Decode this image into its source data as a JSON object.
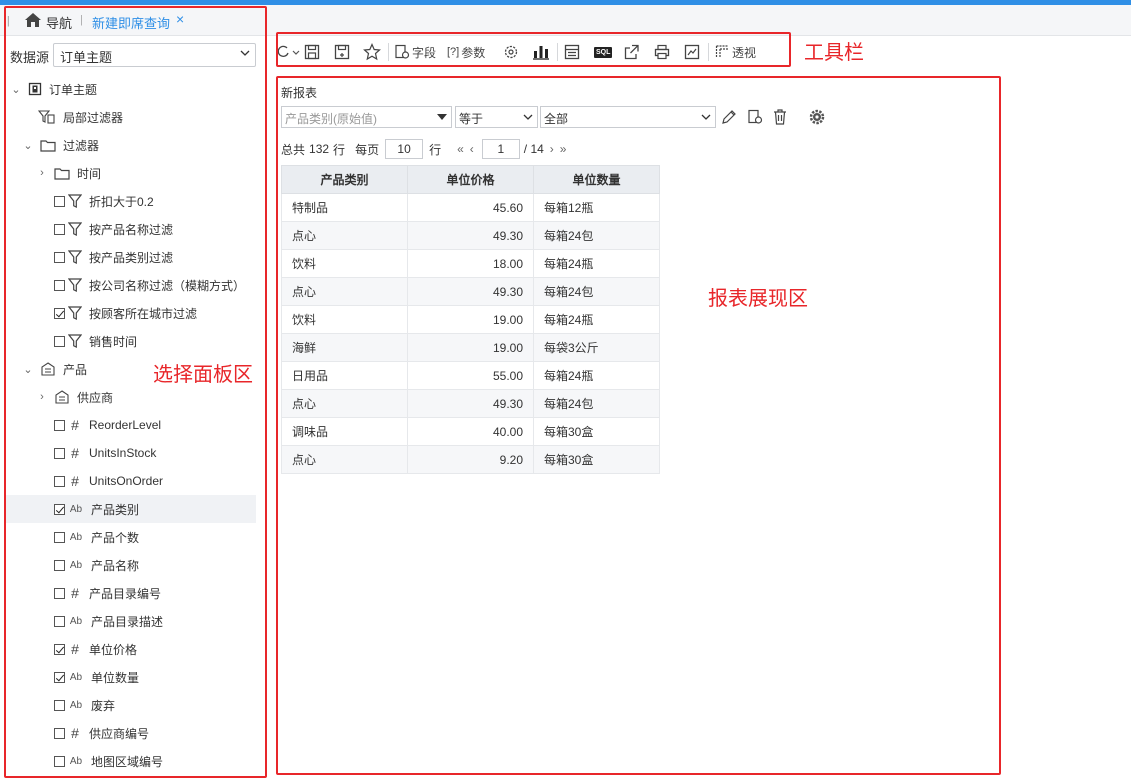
{
  "tabs": {
    "nav_label": "导航",
    "active_tab": "新建即席查询"
  },
  "datasource": {
    "label": "数据源",
    "value": "订单主题"
  },
  "tree": [
    {
      "label": "订单主题",
      "icon": "theme-icon",
      "twisty": "open",
      "checkbox": null
    },
    {
      "label": "局部过滤器",
      "icon": "local-filter-icon",
      "twisty": null,
      "checkbox": null
    },
    {
      "label": "过滤器",
      "icon": "folder-icon",
      "twisty": "open",
      "checkbox": null
    },
    {
      "label": "时间",
      "icon": "folder-icon",
      "twisty": "closed",
      "checkbox": null
    },
    {
      "label": "折扣大于0.2",
      "icon": "filter-icon",
      "twisty": null,
      "checkbox": false
    },
    {
      "label": "按产品名称过滤",
      "icon": "filter-icon",
      "twisty": null,
      "checkbox": false
    },
    {
      "label": "按产品类别过滤",
      "icon": "filter-icon",
      "twisty": null,
      "checkbox": false
    },
    {
      "label": "按公司名称过滤（模糊方式）",
      "icon": "filter-icon",
      "twisty": null,
      "checkbox": false
    },
    {
      "label": "按顾客所在城市过滤",
      "icon": "filter-icon",
      "twisty": null,
      "checkbox": true
    },
    {
      "label": "销售时间",
      "icon": "filter-icon",
      "twisty": null,
      "checkbox": false
    },
    {
      "label": "产品",
      "icon": "table-icon",
      "twisty": "open",
      "checkbox": null
    },
    {
      "label": "供应商",
      "icon": "table-icon",
      "twisty": "closed",
      "checkbox": null
    },
    {
      "label": "ReorderLevel",
      "icon": "number-icon",
      "twisty": null,
      "checkbox": false
    },
    {
      "label": "UnitsInStock",
      "icon": "number-icon",
      "twisty": null,
      "checkbox": false
    },
    {
      "label": "UnitsOnOrder",
      "icon": "number-icon",
      "twisty": null,
      "checkbox": false
    },
    {
      "label": "产品类别",
      "icon": "text-icon",
      "twisty": null,
      "checkbox": true
    },
    {
      "label": "产品个数",
      "icon": "text-icon",
      "twisty": null,
      "checkbox": false
    },
    {
      "label": "产品名称",
      "icon": "text-icon",
      "twisty": null,
      "checkbox": false
    },
    {
      "label": "产品目录编号",
      "icon": "number-icon",
      "twisty": null,
      "checkbox": false
    },
    {
      "label": "产品目录描述",
      "icon": "text-icon",
      "twisty": null,
      "checkbox": false
    },
    {
      "label": "单位价格",
      "icon": "number-icon",
      "twisty": null,
      "checkbox": true
    },
    {
      "label": "单位数量",
      "icon": "text-icon",
      "twisty": null,
      "checkbox": true
    },
    {
      "label": "废弃",
      "icon": "text-icon",
      "twisty": null,
      "checkbox": false
    },
    {
      "label": "供应商编号",
      "icon": "number-icon",
      "twisty": null,
      "checkbox": false
    },
    {
      "label": "地图区域编号",
      "icon": "text-icon",
      "twisty": null,
      "checkbox": false
    }
  ],
  "toolbar": {
    "field_label": "字段",
    "param_label": "参数",
    "pivot_label": "透视"
  },
  "annotations": {
    "toolbar": "工具栏",
    "panel": "选择面板区",
    "report": "报表展现区"
  },
  "report": {
    "title": "新报表",
    "filter": {
      "field_placeholder": "产品类别(原始值)",
      "operator": "等于",
      "value": "全部"
    },
    "pager": {
      "total_prefix": "总共",
      "total": "132",
      "total_suffix": "行",
      "per_page_label": "每页",
      "per_page": "10",
      "rows_unit": "行",
      "page": "1",
      "pages": "/ 14"
    },
    "columns": [
      "产品类别",
      "单位价格",
      "单位数量"
    ],
    "rows": [
      [
        "特制品",
        "45.60",
        "每箱12瓶"
      ],
      [
        "点心",
        "49.30",
        "每箱24包"
      ],
      [
        "饮料",
        "18.00",
        "每箱24瓶"
      ],
      [
        "点心",
        "49.30",
        "每箱24包"
      ],
      [
        "饮料",
        "19.00",
        "每箱24瓶"
      ],
      [
        "海鲜",
        "19.00",
        "每袋3公斤"
      ],
      [
        "日用品",
        "55.00",
        "每箱24瓶"
      ],
      [
        "点心",
        "49.30",
        "每箱24包"
      ],
      [
        "调味品",
        "40.00",
        "每箱30盒"
      ],
      [
        "点心",
        "9.20",
        "每箱30盒"
      ]
    ]
  },
  "colors": {
    "accent": "#2f8fe6",
    "annotation": "#e8262a"
  }
}
